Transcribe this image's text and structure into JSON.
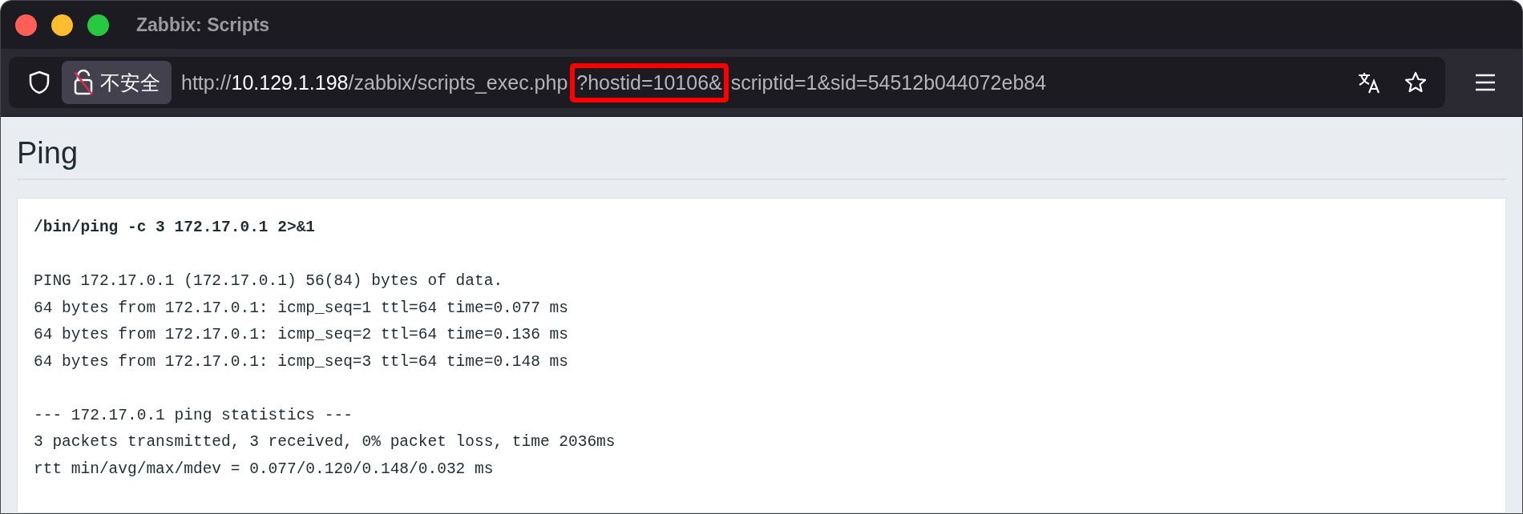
{
  "window": {
    "title": "Zabbix: Scripts"
  },
  "address_bar": {
    "security_label": "不安全",
    "url": [
      {
        "kind": "dim",
        "text": "http://"
      },
      {
        "kind": "host",
        "text": "10.129.1.198"
      },
      {
        "kind": "dim",
        "text": "/zabbix/scripts_exec.php"
      },
      {
        "kind": "highlighted",
        "text": "?hostid=10106&"
      },
      {
        "kind": "dim",
        "text": "scriptid=1&sid=54512b044072eb84"
      }
    ]
  },
  "page": {
    "heading": "Ping",
    "command": "/bin/ping -c 3 172.17.0.1 2>&1",
    "output": [
      {
        "lines": [
          "PING 172.17.0.1 (172.17.0.1) 56(84) bytes of data.",
          "64 bytes from 172.17.0.1: icmp_seq=1 ttl=64 time=0.077 ms",
          "64 bytes from 172.17.0.1: icmp_seq=2 ttl=64 time=0.136 ms",
          "64 bytes from 172.17.0.1: icmp_seq=3 ttl=64 time=0.148 ms"
        ]
      },
      {
        "lines": [
          "--- 172.17.0.1 ping statistics ---",
          "3 packets transmitted, 3 received, 0% packet loss, time 2036ms",
          "rtt min/avg/max/mdev = 0.077/0.120/0.148/0.032 ms"
        ]
      }
    ]
  }
}
